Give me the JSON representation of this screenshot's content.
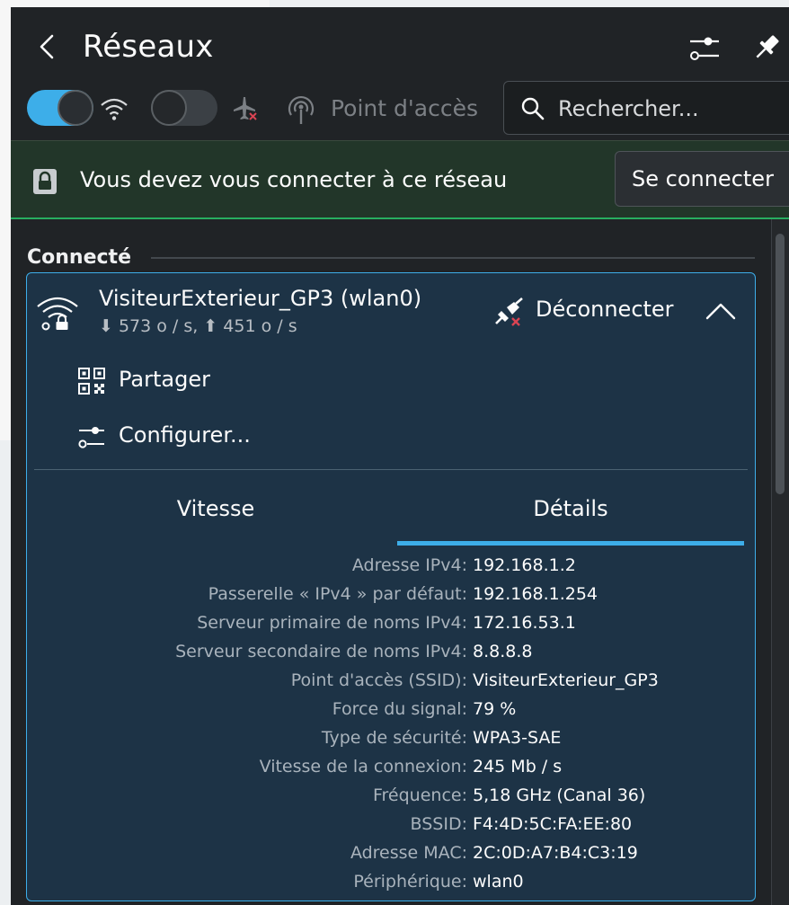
{
  "header": {
    "title": "Réseaux"
  },
  "toolbar": {
    "wifi_enabled": true,
    "airplane_mode": false,
    "hotspot_label": "Point d'accès",
    "search_placeholder": "Rechercher..."
  },
  "banner": {
    "message": "Vous devez vous connecter à ce réseau",
    "button_label": "Se connecter"
  },
  "section": {
    "title": "Connecté"
  },
  "connection": {
    "name": "VisiteurExterieur_GP3 (wlan0)",
    "speed": "⬇ 573 o / s, ⬆ 451 o / s",
    "disconnect_label": "Déconnecter",
    "actions": {
      "share": "Partager",
      "configure": "Configurer..."
    },
    "tabs": {
      "speed": "Vitesse",
      "details": "Détails"
    },
    "details": [
      {
        "label": "Adresse IPv4:",
        "value": "192.168.1.2"
      },
      {
        "label": "Passerelle « IPv4 » par défaut:",
        "value": "192.168.1.254"
      },
      {
        "label": "Serveur primaire de noms IPv4:",
        "value": "172.16.53.1"
      },
      {
        "label": "Serveur secondaire de noms IPv4:",
        "value": "8.8.8.8"
      },
      {
        "label": "Point d'accès (SSID):",
        "value": "VisiteurExterieur_GP3"
      },
      {
        "label": "Force du signal:",
        "value": "79 %"
      },
      {
        "label": "Type de sécurité:",
        "value": "WPA3-SAE"
      },
      {
        "label": "Vitesse de la connexion:",
        "value": "245 Mb / s"
      },
      {
        "label": "Fréquence:",
        "value": "5,18 GHz (Canal 36)"
      },
      {
        "label": "BSSID:",
        "value": "F4:4D:5C:FA:EE:80"
      },
      {
        "label": "Adresse MAC:",
        "value": "2C:0D:A7:B4:C3:19"
      },
      {
        "label": "Périphérique:",
        "value": "wlan0"
      }
    ]
  },
  "colors": {
    "accent": "#3daee9",
    "panel_bg": "#202326",
    "card_bg": "#1d3346",
    "banner_bg": "#223629",
    "banner_border": "#27ae60"
  },
  "icons": [
    "back-icon",
    "settings-icon",
    "pin-icon",
    "wifi-icon",
    "airplane-icon",
    "hotspot-icon",
    "search-icon",
    "lock-icon",
    "wifi-lock-icon",
    "disconnect-icon",
    "chevron-up-icon",
    "qr-code-icon",
    "configure-icon"
  ]
}
